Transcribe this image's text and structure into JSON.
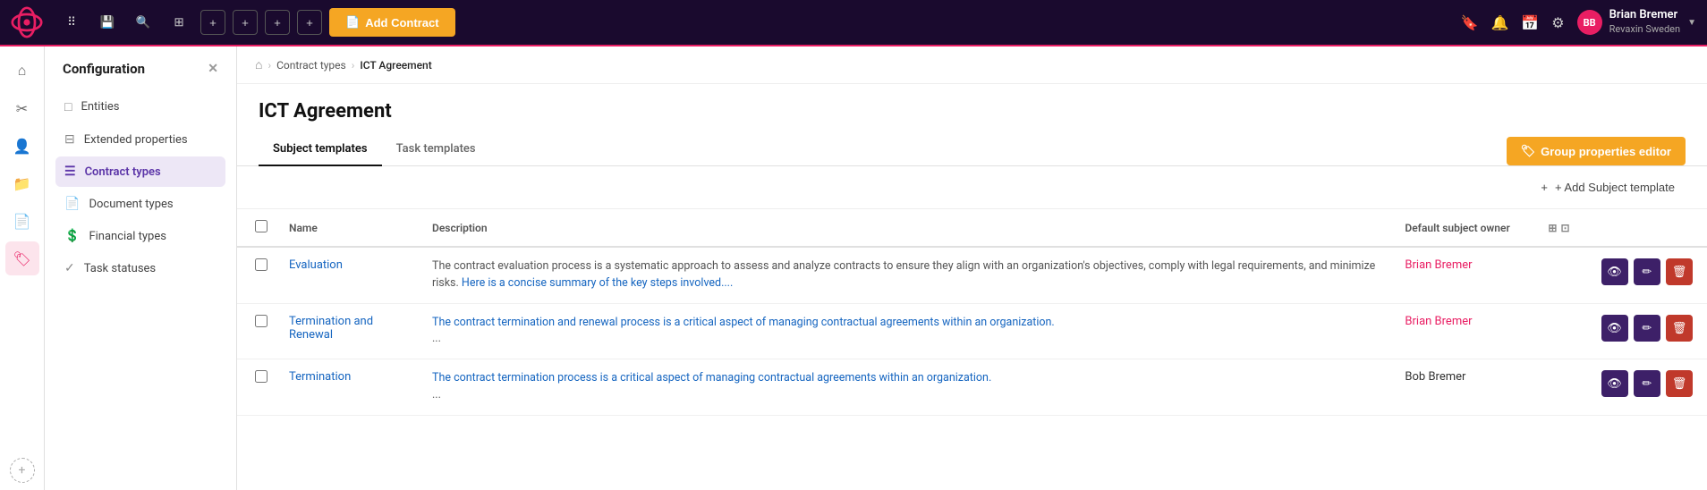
{
  "app": {
    "logo_alt": "Revaxin",
    "brand_color": "#e91e63"
  },
  "top_nav": {
    "add_contract_label": "Add Contract",
    "user": {
      "name": "Brian Bremer",
      "company": "Revaxin Sweden",
      "initials": "BB"
    }
  },
  "icon_sidebar": {
    "items": [
      {
        "name": "home-icon",
        "symbol": "⌂"
      },
      {
        "name": "tools-icon",
        "symbol": "✂"
      },
      {
        "name": "people-icon",
        "symbol": "👤"
      },
      {
        "name": "folder-icon",
        "symbol": "📁"
      },
      {
        "name": "document-icon",
        "symbol": "📄"
      },
      {
        "name": "tag-icon",
        "symbol": "🏷",
        "active": true
      }
    ]
  },
  "config_sidebar": {
    "title": "Configuration",
    "close_label": "×",
    "items": [
      {
        "label": "Entities",
        "icon": "□",
        "active": false
      },
      {
        "label": "Extended properties",
        "icon": "⊟",
        "active": false
      },
      {
        "label": "Contract types",
        "icon": "☰",
        "active": true
      },
      {
        "label": "Document types",
        "icon": "📄",
        "active": false
      },
      {
        "label": "Financial types",
        "icon": "💲",
        "active": false
      },
      {
        "label": "Task statuses",
        "icon": "✓",
        "active": false
      }
    ]
  },
  "breadcrumb": {
    "home_label": "⌂",
    "contract_types_label": "Contract types",
    "current_label": "ICT Agreement"
  },
  "page": {
    "title": "ICT Agreement"
  },
  "tabs": [
    {
      "label": "Subject templates",
      "active": true
    },
    {
      "label": "Task templates",
      "active": false
    }
  ],
  "toolbar": {
    "group_props_label": "Group properties editor",
    "add_subject_label": "+ Add Subject template"
  },
  "table": {
    "columns": [
      {
        "label": "",
        "key": "check"
      },
      {
        "label": "Name",
        "key": "name"
      },
      {
        "label": "Description",
        "key": "description"
      },
      {
        "label": "Default subject owner",
        "key": "owner"
      },
      {
        "label": "",
        "key": "col_icons"
      },
      {
        "label": "",
        "key": "actions"
      }
    ],
    "rows": [
      {
        "name": "Evaluation",
        "description_parts": [
          {
            "text": "The contract evaluation process is a systematic approach to assess and analyze contracts to ensure they align with an organization's objectives, comply with legal requirements, and minimize risks. ",
            "highlight": false
          },
          {
            "text": "Here is a concise summary of the key steps involved....",
            "highlight": true
          }
        ],
        "owner": "Brian Bremer",
        "owner_highlight": true
      },
      {
        "name": "Termination and Renewal",
        "description_parts": [
          {
            "text": "The contract termination and renewal process is a critical aspect of managing contractual agreements within an organization.",
            "highlight": false
          },
          {
            "text": " ...",
            "highlight": false
          }
        ],
        "owner": "Brian Bremer",
        "owner_highlight": true
      },
      {
        "name": "Termination",
        "description_parts": [
          {
            "text": "The contract termination process is a critical aspect of managing contractual agreements within an organization.",
            "highlight": false
          },
          {
            "text": " ...",
            "highlight": false
          }
        ],
        "owner": "Bob Bremer",
        "owner_highlight": false
      }
    ]
  }
}
